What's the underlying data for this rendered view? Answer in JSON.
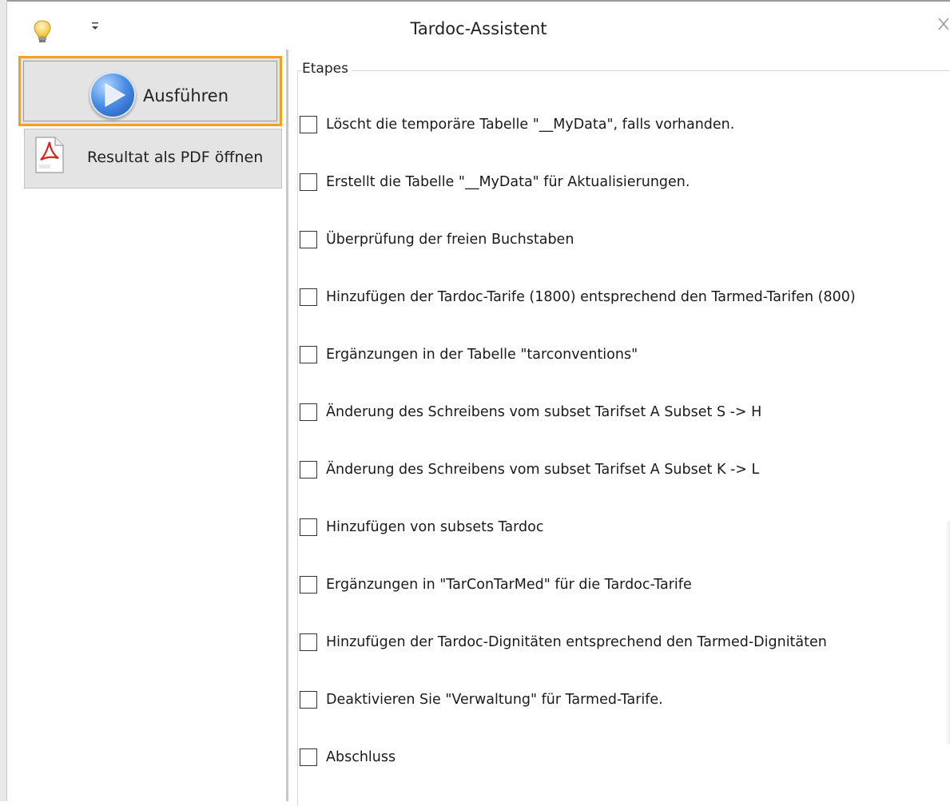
{
  "window": {
    "title": "Tardoc-Assistent",
    "quick_access_icon": "customize-quick-access-icon",
    "help_icon": "lightbulb-icon",
    "close_icon": "close-icon"
  },
  "actions": {
    "run_label": "Ausführen",
    "run_icon": "play-icon",
    "pdf_label": "Resultat als PDF öffnen",
    "pdf_icon": "pdf-file-icon"
  },
  "steps": {
    "legend": "Etapes",
    "items": [
      {
        "label": "Löscht die temporäre Tabelle \"__MyData\", falls vorhanden.",
        "checked": false
      },
      {
        "label": "Erstellt die Tabelle \"__MyData\" für Aktualisierungen.",
        "checked": false
      },
      {
        "label": "Überprüfung der freien Buchstaben",
        "checked": false
      },
      {
        "label": "Hinzufügen der Tardoc-Tarife (1800) entsprechend den Tarmed-Tarifen (800)",
        "checked": false
      },
      {
        "label": "Ergänzungen in der Tabelle \"tarconventions\"",
        "checked": false
      },
      {
        "label": "Änderung des Schreibens vom subset  Tarifset A Subset S -> H",
        "checked": false
      },
      {
        "label": "Änderung des Schreibens vom subset  Tarifset A Subset K -> L",
        "checked": false
      },
      {
        "label": "Hinzufügen von subsets Tardoc",
        "checked": false
      },
      {
        "label": "Ergänzungen in \"TarConTarMed\" für die Tardoc-Tarife",
        "checked": false
      },
      {
        "label": "Hinzufügen der Tardoc-Dignitäten entsprechend den Tarmed-Dignitäten",
        "checked": false
      },
      {
        "label": "Deaktivieren Sie \"Verwaltung\" für Tarmed-Tarife.",
        "checked": false
      },
      {
        "label": "Abschluss",
        "checked": false
      }
    ]
  },
  "colors": {
    "focus_border": "#f0a21a",
    "button_bg": "#e2e2e2",
    "play_blue": "#2f6fd0"
  }
}
